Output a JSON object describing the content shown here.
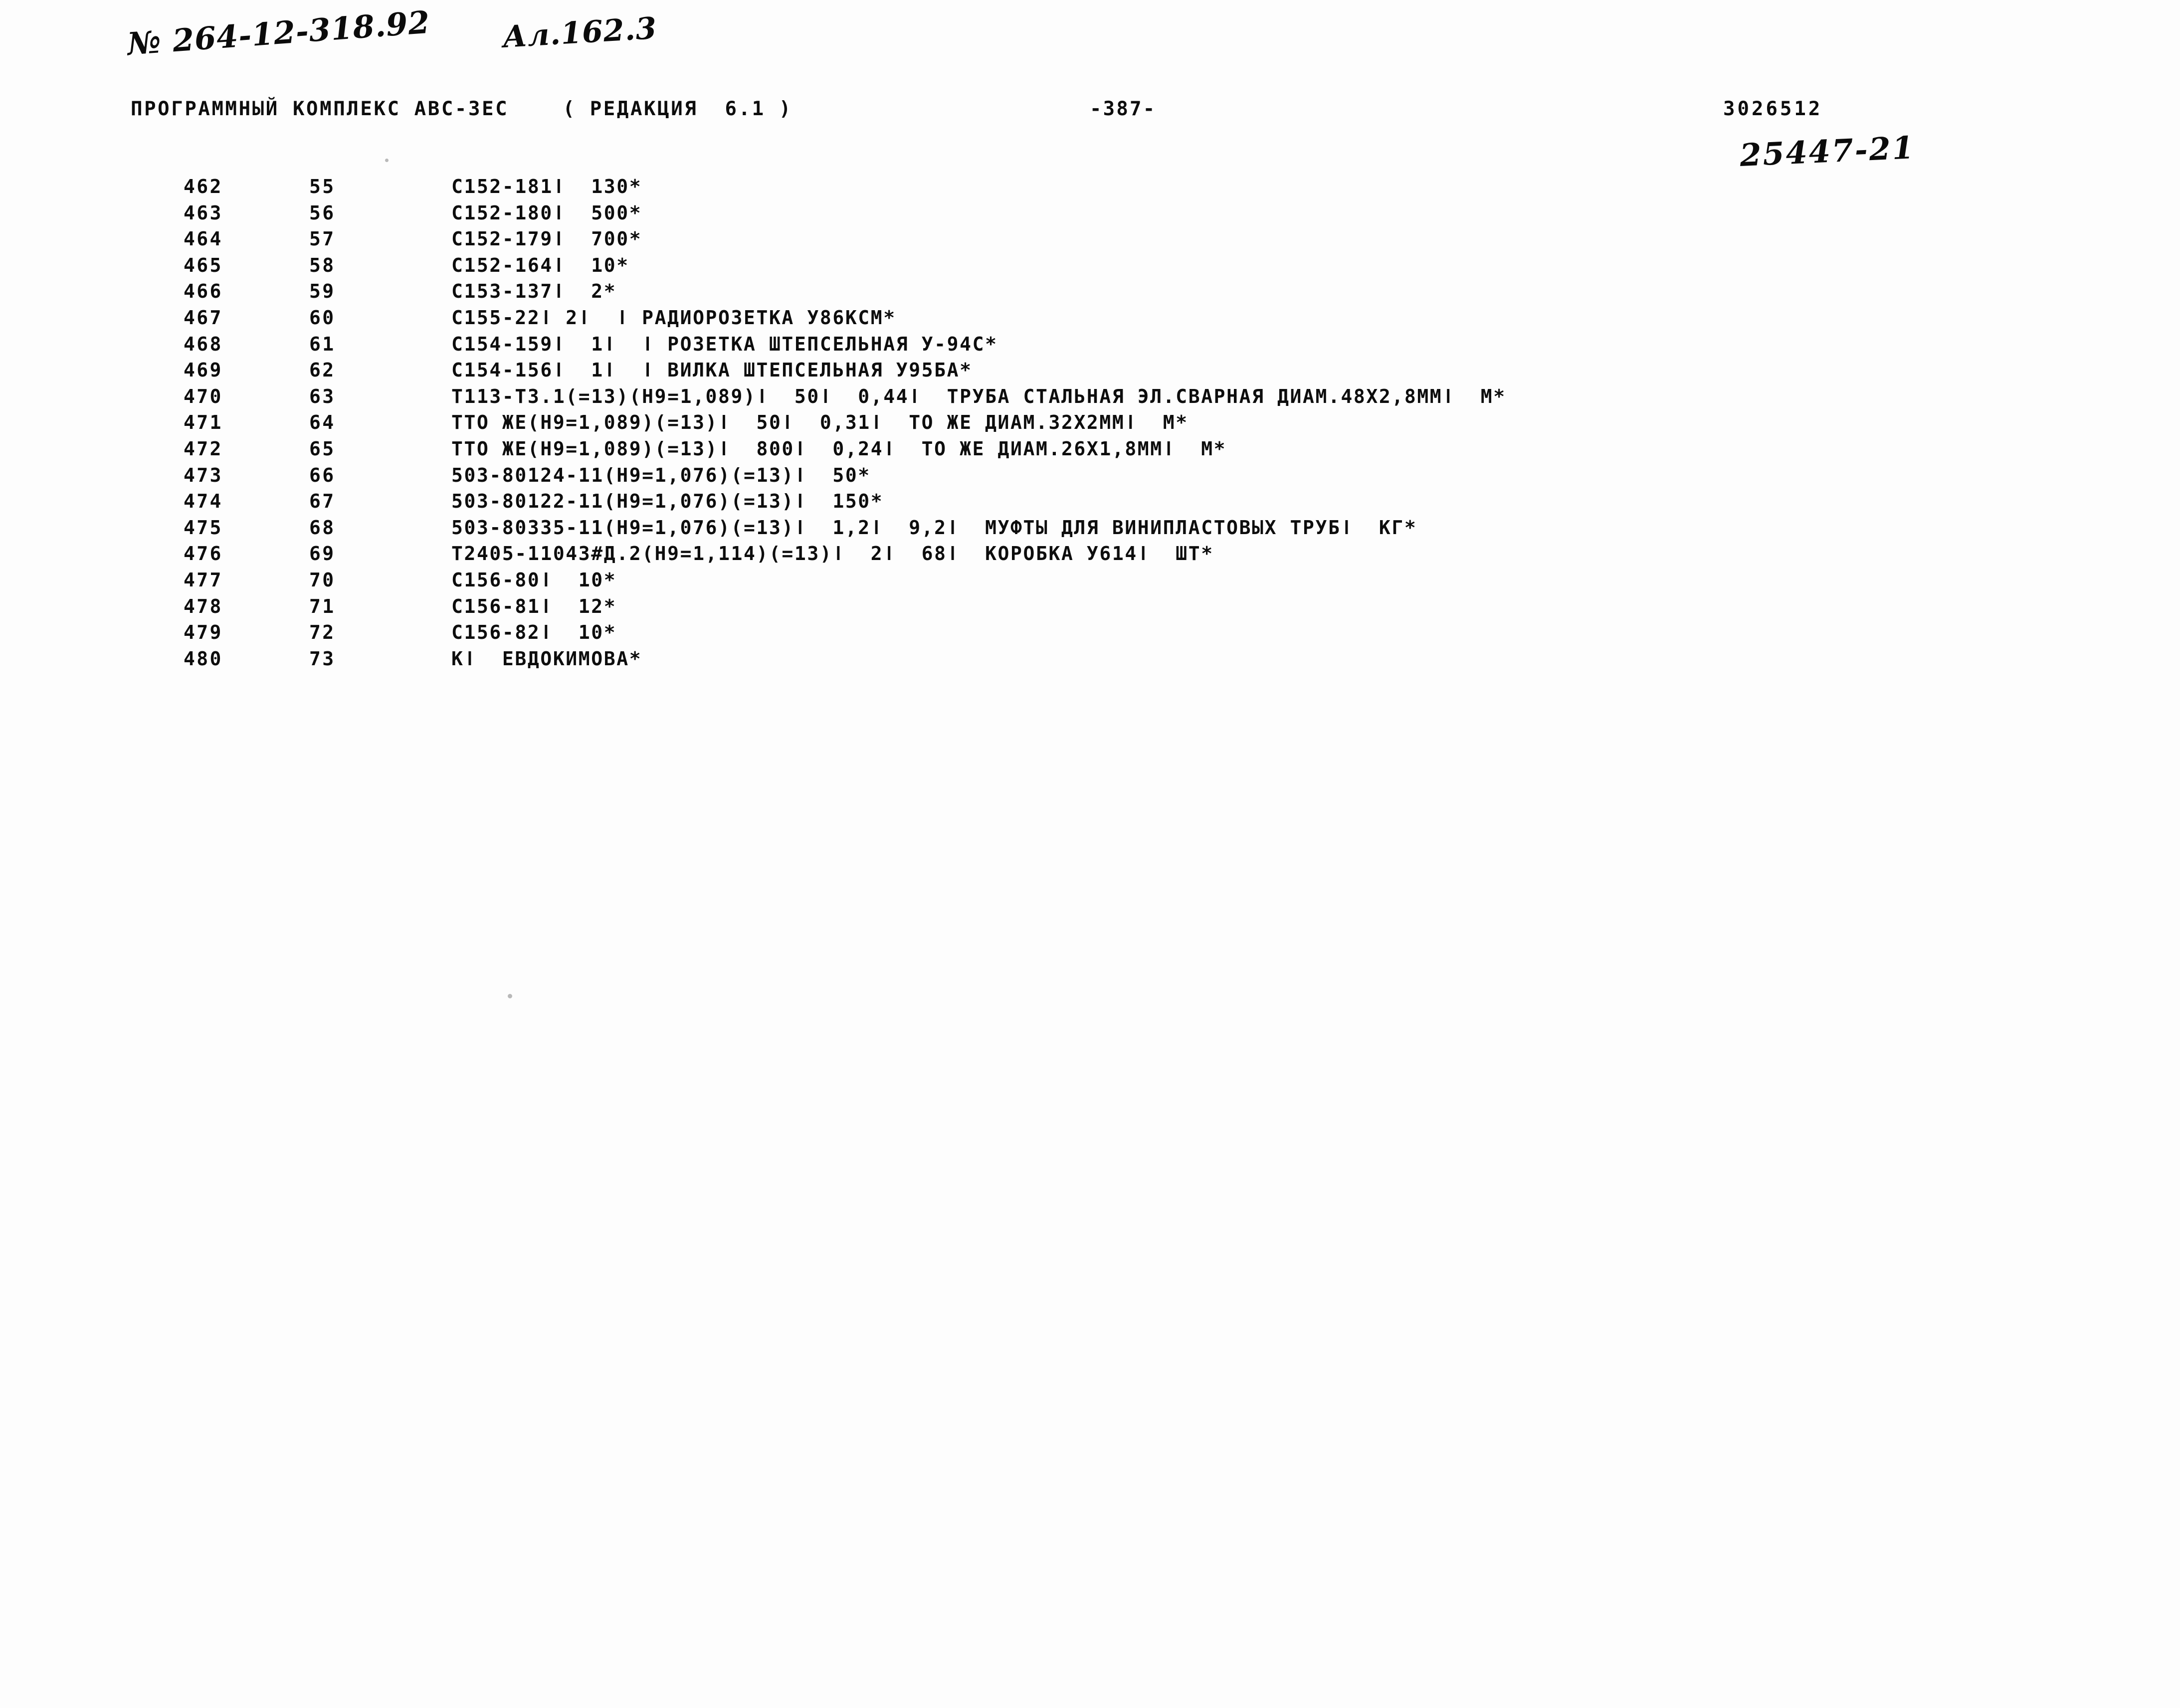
{
  "annotations": {
    "order_number": "№ 264-12-318.92",
    "album_reference": "Ал.162.3",
    "document_number": "25447-21"
  },
  "header": {
    "title": "ПРОГРАММНЫЙ КОМПЛЕКС АВС-3ЕС    ( РЕДАКЦИЯ  6.1 )",
    "page_number": "-387-",
    "sheet_code": "3026512"
  },
  "listing": {
    "rows": [
      {
        "line": "462",
        "seq": "55",
        "text": "С152-181ǀ  130*"
      },
      {
        "line": "463",
        "seq": "56",
        "text": "С152-180ǀ  500*"
      },
      {
        "line": "464",
        "seq": "57",
        "text": "С152-179ǀ  700*"
      },
      {
        "line": "465",
        "seq": "58",
        "text": "С152-164ǀ  10*"
      },
      {
        "line": "466",
        "seq": "59",
        "text": "С153-137ǀ  2*"
      },
      {
        "line": "467",
        "seq": "60",
        "text": "С155-22ǀ 2ǀ  ǀ РАДИОРОЗЕТКА У86КСМ*"
      },
      {
        "line": "468",
        "seq": "61",
        "text": "С154-159ǀ  1ǀ  ǀ РОЗЕТКА ШТЕПСЕЛЬНАЯ У-94С*"
      },
      {
        "line": "469",
        "seq": "62",
        "text": "С154-156ǀ  1ǀ  ǀ ВИЛКА ШТЕПСЕЛЬНАЯ У95БА*"
      },
      {
        "line": "470",
        "seq": "63",
        "text": "Т113-Т3.1(=13)(Н9=1,089)ǀ  50ǀ  0,44ǀ  ТРУБА СТАЛЬНАЯ ЭЛ.СВАРНАЯ ДИАМ.48Х2,8ММǀ  М*"
      },
      {
        "line": "471",
        "seq": "64",
        "text": "ТТО ЖЕ(Н9=1,089)(=13)ǀ  50ǀ  0,31ǀ  ТО ЖЕ ДИАМ.32Х2ММǀ  М*"
      },
      {
        "line": "472",
        "seq": "65",
        "text": "ТТО ЖЕ(Н9=1,089)(=13)ǀ  800ǀ  0,24ǀ  ТО ЖЕ ДИАМ.26Х1,8ММǀ  М*"
      },
      {
        "line": "473",
        "seq": "66",
        "text": "503-80124-11(Н9=1,076)(=13)ǀ  50*"
      },
      {
        "line": "474",
        "seq": "67",
        "text": "503-80122-11(Н9=1,076)(=13)ǀ  150*"
      },
      {
        "line": "475",
        "seq": "68",
        "text": "503-80335-11(Н9=1,076)(=13)ǀ  1,2ǀ  9,2ǀ  МУФТЫ ДЛЯ ВИНИПЛАСТОВЫХ ТРУБǀ  КГ*"
      },
      {
        "line": "476",
        "seq": "69",
        "text": "Т2405-11043#Д.2(Н9=1,114)(=13)ǀ  2ǀ  68ǀ  КОРОБКА У614ǀ  ШТ*"
      },
      {
        "line": "477",
        "seq": "70",
        "text": "С156-80ǀ  10*"
      },
      {
        "line": "478",
        "seq": "71",
        "text": "С156-81ǀ  12*"
      },
      {
        "line": "479",
        "seq": "72",
        "text": "С156-82ǀ  10*"
      },
      {
        "line": "480",
        "seq": "73",
        "text": "Кǀ  ЕВДОКИМОВА*"
      }
    ]
  },
  "colors": {
    "ink": "#0d0d0d",
    "paper": "#fdfdfd"
  }
}
